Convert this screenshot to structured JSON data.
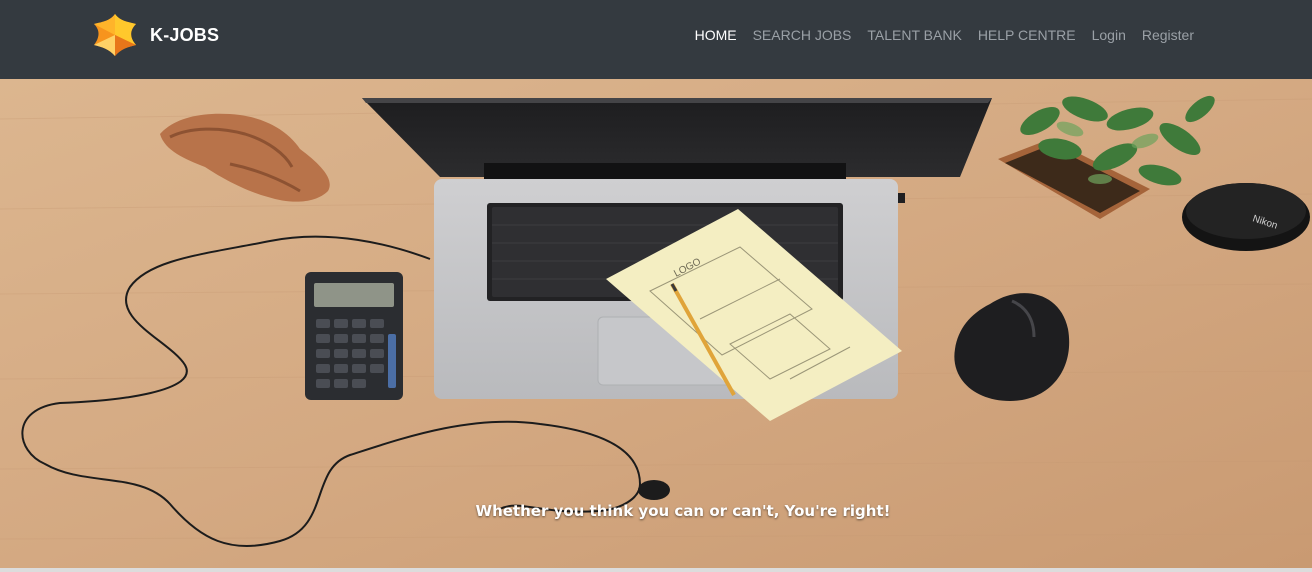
{
  "brand": {
    "name": "K-JOBS",
    "logo_icon": "k-jobs-logo-icon"
  },
  "nav": [
    {
      "label": "HOME",
      "active": true
    },
    {
      "label": "SEARCH JOBS",
      "active": false
    },
    {
      "label": "TALENT BANK",
      "active": false
    },
    {
      "label": "HELP CENTRE",
      "active": false
    },
    {
      "label": "Login",
      "active": false
    },
    {
      "label": "Register",
      "active": false
    }
  ],
  "hero": {
    "tagline": "Whether you think you can or can't, You're right!",
    "image_labels": {
      "sketch_word": "LOGO",
      "camera_brand": "Nikon"
    }
  },
  "colors": {
    "navbar_bg": "#343a40",
    "nav_link": "#9aa0a6",
    "nav_link_active": "#ffffff",
    "logo_orange": "#f7941d",
    "logo_yellow": "#ffc82c"
  }
}
